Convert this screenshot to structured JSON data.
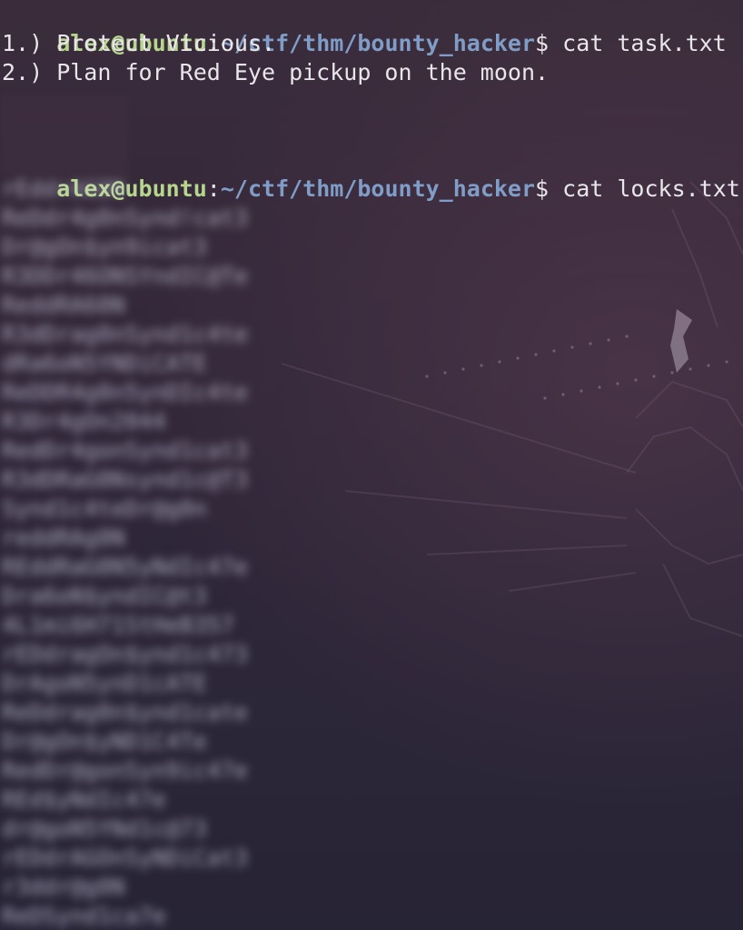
{
  "prompt": {
    "user": "alex@ubuntu",
    "colon": ":",
    "path": "~/ctf/thm/bounty_hacker",
    "dollar": "$"
  },
  "commands": [
    {
      "command": " cat task.txt",
      "output": [
        "1.) Protect Vicious.",
        "2.) Plan for Red Eye pickup on the moon."
      ]
    },
    {
      "command": " cat locks.txt",
      "output_blurred": [
        "rEddrAGON",
        "ReDdr4g0nSynd!cat3",
        "Dr@gOn$yn9icat3",
        "R3DDr46ONSYndIC@Te",
        "ReddRA60N",
        "R3dDrag0nSynd1c4te",
        "dRa6oN5YNDiCATE",
        "ReDDR4g0n5ynDIc4te",
        "R3Dr4gOn2044",
        "RedDr4gonSynd1cat3",
        "R3dDRaG0Nsynd1c@T3",
        "Synd1c4teDr@g0n",
        "reddRAg0N",
        "REddRaG0N5yNdIc47e",
        "Dra6oN$yndIC@t3",
        "4L1mi6H71StHeB357",
        "rEDdragOn$ynd1c473",
        "DrAgoN5ynD1cATE",
        "ReDdrag0n$ynd1cate",
        "Dr@gOn$yND1C4Te",
        "RedDr@gonSyn9ic47e",
        "REd$yNdIc47e",
        "dr@goN5YNd1c@73",
        "rEDdrAGOnSyNDiCat3",
        "r3ddr@g0N",
        "ReDSynd1ca7e"
      ]
    }
  ]
}
